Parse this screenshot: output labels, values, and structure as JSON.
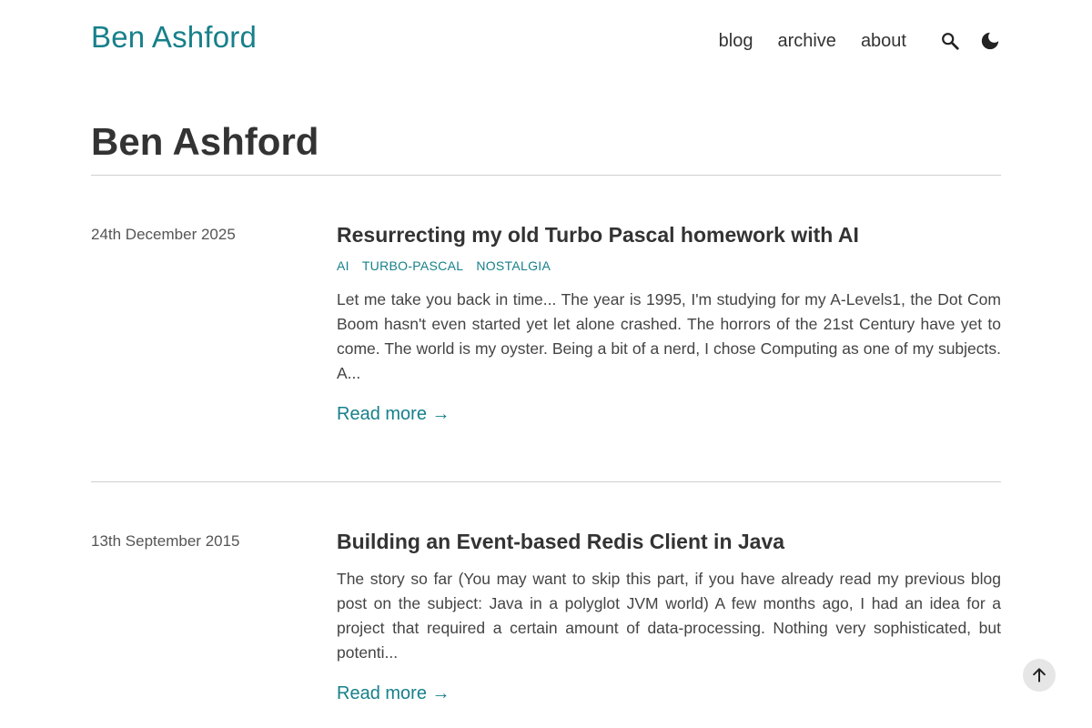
{
  "header": {
    "site_title": "Ben Ashford",
    "nav": [
      {
        "label": "blog"
      },
      {
        "label": "archive"
      },
      {
        "label": "about"
      }
    ],
    "icons": {
      "search": "search-icon",
      "theme": "moon-icon"
    }
  },
  "page": {
    "heading": "Ben Ashford"
  },
  "posts": [
    {
      "date": "24th December 2025",
      "title": "Resurrecting my old Turbo Pascal homework with AI",
      "tags": [
        "AI",
        "TURBO-PASCAL",
        "NOSTALGIA"
      ],
      "excerpt": "Let me take you back in time... The year is 1995, I'm studying for my A-Levels1, the Dot Com Boom hasn't even started yet let alone crashed. The horrors of the 21st Century have yet to come. The world is my oyster. Being a bit of a nerd, I chose Computing as one of my subjects. A...",
      "read_more": "Read more →"
    },
    {
      "date": "13th September 2015",
      "title": "Building an Event-based Redis Client in Java",
      "tags": [],
      "excerpt": "The story so far (You may want to skip this part, if you have already read my previous blog post on the subject: Java in a polyglot JVM world) A few months ago, I had an idea for a project that required a certain amount of data-processing. Nothing very sophisticated, but potenti...",
      "read_more": "Read more →"
    }
  ],
  "back_to_top": {
    "icon": "arrow-up-icon"
  },
  "colors": {
    "accent": "#17808b",
    "text": "#333333",
    "rule": "#d0d0d0"
  }
}
